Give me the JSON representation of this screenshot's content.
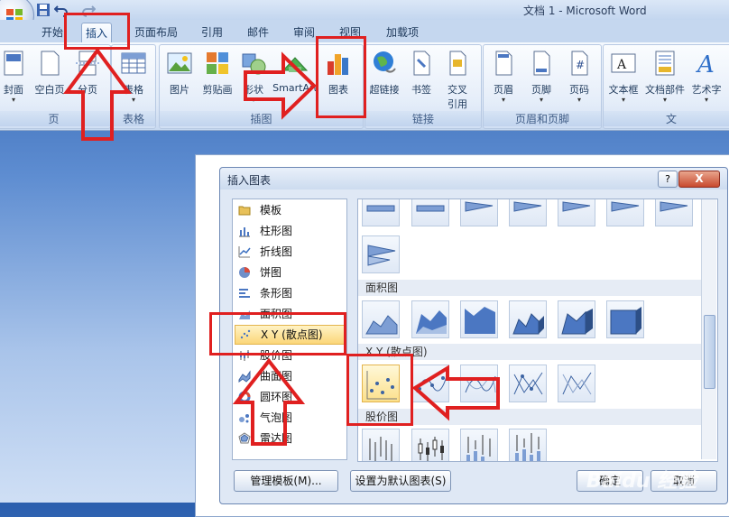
{
  "window": {
    "title": "文档 1 - Microsoft Word"
  },
  "tabs": [
    {
      "label": "开始"
    },
    {
      "label": "插入"
    },
    {
      "label": "页面布局"
    },
    {
      "label": "引用"
    },
    {
      "label": "邮件"
    },
    {
      "label": "审阅"
    },
    {
      "label": "视图"
    },
    {
      "label": "加载项"
    }
  ],
  "ribbon": {
    "groups": {
      "pages": "页",
      "tables": "表格",
      "illustrations": "插图",
      "links": "链接",
      "header_footer": "页眉和页脚",
      "text": "文"
    },
    "buttons": {
      "cover": "封面",
      "blank_page": "空白页",
      "page_break": "分页",
      "table": "表格",
      "picture": "图片",
      "clipart": "剪贴画",
      "shapes": "形状",
      "smartart": "SmartArt",
      "chart": "图表",
      "hyperlink": "超链接",
      "bookmark": "书签",
      "cross_ref_1": "交叉",
      "cross_ref_2": "引用",
      "header": "页眉",
      "footer": "页脚",
      "page_number": "页码",
      "textbox": "文本框",
      "quick_parts": "文档部件",
      "wordart": "艺术字"
    }
  },
  "dialog": {
    "title": "插入图表",
    "help": "?",
    "close": "X",
    "chart_types": [
      {
        "label": "模板",
        "icon": "folder-icon"
      },
      {
        "label": "柱形图",
        "icon": "column-chart-icon"
      },
      {
        "label": "折线图",
        "icon": "line-chart-icon"
      },
      {
        "label": "饼图",
        "icon": "pie-chart-icon"
      },
      {
        "label": "条形图",
        "icon": "bar-chart-icon"
      },
      {
        "label": "面积图",
        "icon": "area-chart-icon"
      },
      {
        "label": "X Y (散点图)",
        "icon": "scatter-chart-icon"
      },
      {
        "label": "股价图",
        "icon": "stock-chart-icon"
      },
      {
        "label": "曲面图",
        "icon": "surface-chart-icon"
      },
      {
        "label": "圆环图",
        "icon": "doughnut-chart-icon"
      },
      {
        "label": "气泡图",
        "icon": "bubble-chart-icon"
      },
      {
        "label": "雷达图",
        "icon": "radar-chart-icon"
      }
    ],
    "selected_type": "X Y (散点图)",
    "sections": {
      "area": "面积图",
      "scatter": "X Y (散点图)",
      "stock": "股价图"
    },
    "buttons": {
      "manage_templates": "管理模板(M)...",
      "set_default": "设置为默认图表(S)",
      "ok": "确定",
      "cancel": "取消"
    }
  },
  "watermark": "Baidu 经验",
  "colors": {
    "annotation": "#e02020",
    "selection": "#fbd678",
    "ribbon": "#dfe9f7"
  }
}
